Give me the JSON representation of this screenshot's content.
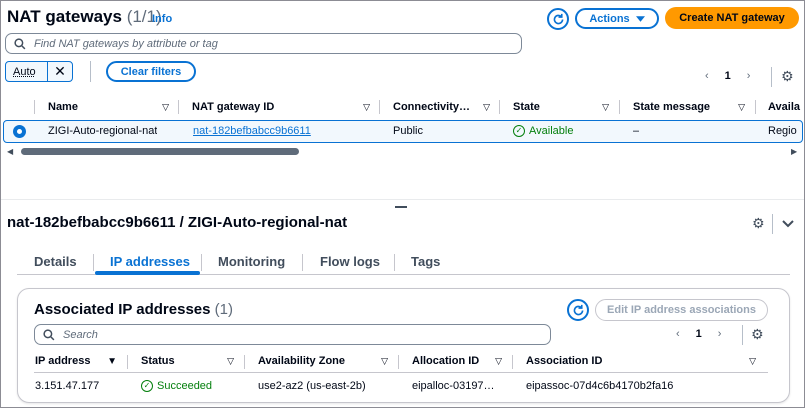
{
  "header": {
    "title": "NAT gateways",
    "count": "(1/1)",
    "info": "Info",
    "actions_label": "Actions",
    "create_label": "Create NAT gateway"
  },
  "search": {
    "placeholder": "Find NAT gateways by attribute or tag"
  },
  "filter": {
    "token": "Auto",
    "clear_label": "Clear filters"
  },
  "pagination": {
    "page": "1"
  },
  "table": {
    "columns": [
      "Name",
      "NAT gateway ID",
      "Connectivity…",
      "State",
      "State message",
      "Availa"
    ],
    "rows": [
      {
        "name": "ZIGI-Auto-regional-nat",
        "id": "nat-182befbabcc9b6611",
        "connectivity": "Public",
        "state": "Available",
        "state_message": "–",
        "availability": "Regio"
      }
    ]
  },
  "detail": {
    "title": "nat-182befbabcc9b6611 / ZIGI-Auto-regional-nat",
    "tabs": [
      "Details",
      "IP addresses",
      "Monitoring",
      "Flow logs",
      "Tags"
    ],
    "active_tab": "IP addresses"
  },
  "ip_section": {
    "title": "Associated IP addresses",
    "count": "(1)",
    "edit_label": "Edit IP address associations",
    "search_placeholder": "Search",
    "page": "1",
    "columns": [
      "IP address",
      "Status",
      "Availability Zone",
      "Allocation ID",
      "Association ID"
    ],
    "rows": [
      {
        "ip": "3.151.47.177",
        "status": "Succeeded",
        "zone": "use2-az2 (us-east-2b)",
        "allocation": "eipalloc-03197…",
        "association": "eipassoc-07d4c6b4170b2fa16"
      }
    ]
  },
  "colors": {
    "accent": "#0972d3",
    "primary_button": "#ff9900",
    "success": "#037f0c"
  }
}
